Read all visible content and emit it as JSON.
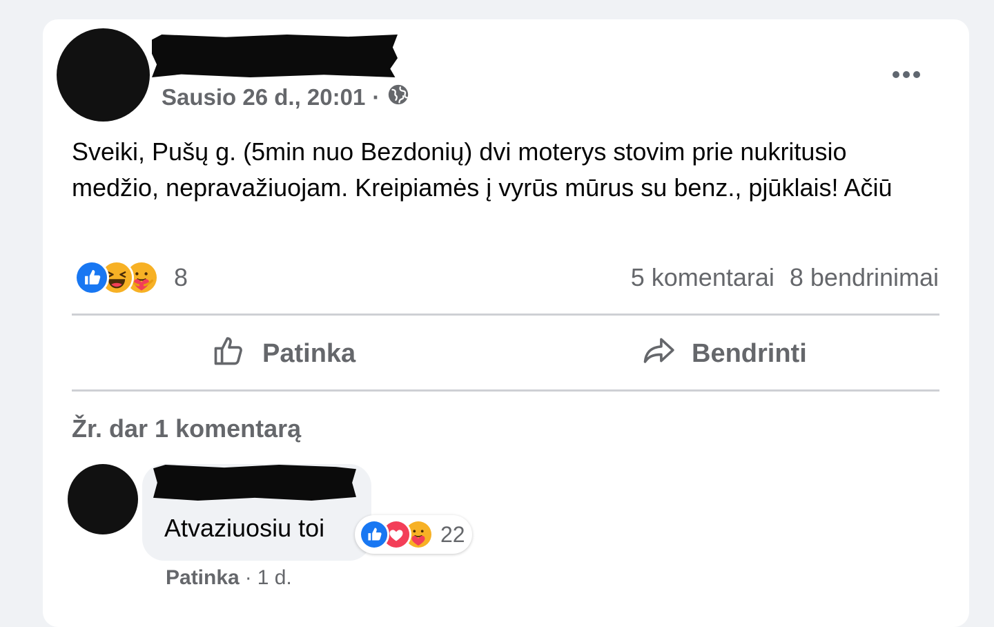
{
  "post": {
    "timestamp": "Sausio 26 d., 20:01",
    "separator": "·",
    "privacy_icon": "globe-icon",
    "more_icon": "more-horizontal-icon",
    "text": "Sveiki, Pušų g. (5min nuo Bezdonių) dvi moterys stovim prie nukritusio medžio, nepravažiuojam. Kreipiamės į vyrūs mūrus su benz., pjūklais! Ačiū",
    "reactions": {
      "icons": [
        "like-icon",
        "haha-icon",
        "care-icon"
      ],
      "count": "8"
    },
    "comments_count": "5 komentarai",
    "shares_count": "8 bendrinimai"
  },
  "actions": {
    "like_label": "Patinka",
    "share_label": "Bendrinti"
  },
  "comments": {
    "view_more": "Žr. dar 1 komentarą",
    "items": [
      {
        "text": "Atvaziuosiu toi",
        "reactions": {
          "icons": [
            "like-icon",
            "love-icon",
            "care-icon"
          ],
          "count": "22"
        },
        "like_label": "Patinka",
        "separator": "·",
        "time": "1 d."
      }
    ]
  },
  "colors": {
    "background": "#f0f2f5",
    "card": "#ffffff",
    "secondary_text": "#65676b",
    "like_blue": "#1877f2",
    "love_red": "#f33e58",
    "yellow": "#f7b125"
  }
}
